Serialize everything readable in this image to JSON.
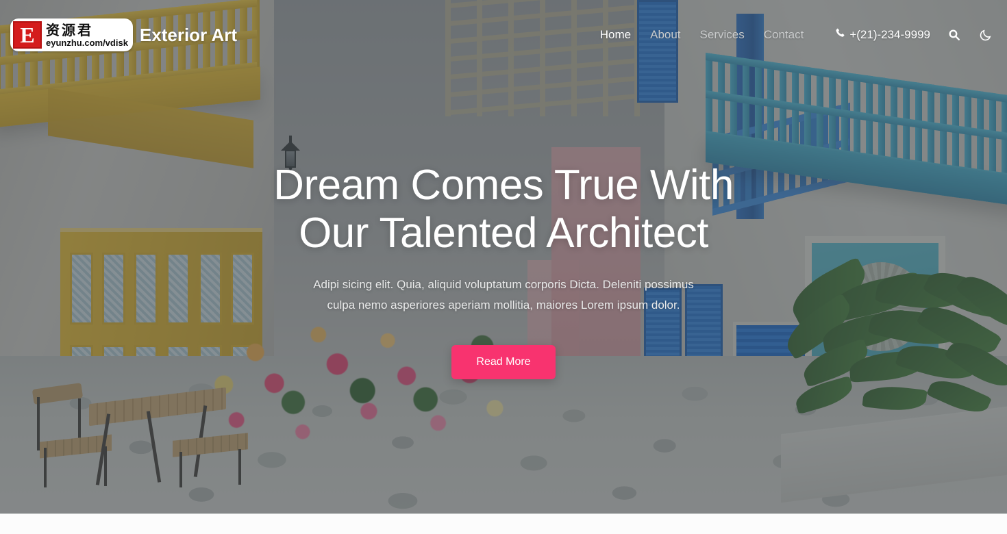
{
  "site": {
    "brand_name": "Exterior Art",
    "watermark": {
      "letter": "E",
      "cn_text": "资源君",
      "url_text": "eyunzhu.com/vdisk"
    }
  },
  "header": {
    "nav_items": [
      {
        "label": "Home",
        "active": true
      },
      {
        "label": "About",
        "active": false
      },
      {
        "label": "Services",
        "active": false
      },
      {
        "label": "Contact",
        "active": false
      }
    ],
    "phone": "+(21)-234-9999",
    "phone_icon": "phone-icon",
    "search_icon": "search-icon",
    "theme_toggle_icon": "moon-icon"
  },
  "hero": {
    "heading_line1": "Dream Comes True With",
    "heading_line2": "Our Talented Architect",
    "paragraph": "Adipi sicing elit. Quia, aliquid voluptatum corporis Dicta. Deleniti possimus culpa nemo asperiores aperiam mollitia, maiores Lorem ipsum dolor.",
    "cta_label": "Read More"
  },
  "colors": {
    "accent_pink": "#f8336f",
    "nav_active": "#ffffff",
    "nav_inactive": "#c9cbcc",
    "overlay": "rgba(66,70,74,0.52)",
    "watermark_red": "#d41c1c",
    "building_yellow": "#e7bb2f",
    "building_blue": "#2f82e0",
    "building_teal": "#3fa9c9",
    "building_pink": "#e0a8ad"
  }
}
